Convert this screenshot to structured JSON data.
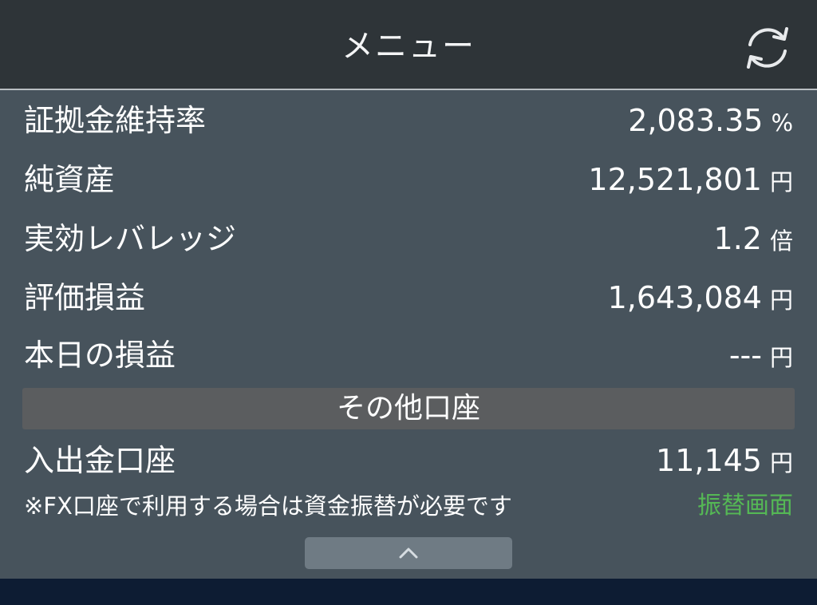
{
  "header": {
    "title": "メニュー",
    "refresh_icon": "refresh-icon"
  },
  "metrics": [
    {
      "label": "証拠金維持率",
      "value": "2,083.35",
      "unit": "%"
    },
    {
      "label": "純資産",
      "value": "12,521,801",
      "unit": "円"
    },
    {
      "label": "実効レバレッジ",
      "value": "1.2",
      "unit": "倍"
    },
    {
      "label": "評価損益",
      "value": "1,643,084",
      "unit": "円"
    },
    {
      "label": "本日の損益",
      "value": "---",
      "unit": "円"
    }
  ],
  "other_accounts": {
    "section_title": "その他口座",
    "deposit": {
      "label": "入出金口座",
      "value": "11,145",
      "unit": "円"
    },
    "note": "※FX口座で利用する場合は資金振替が必要です",
    "transfer_link": "振替画面",
    "transfer_link_color": "#55b855"
  },
  "collapse": {
    "icon": "chevron-up-icon"
  },
  "colors": {
    "header_bg": "#2e3438",
    "content_bg": "#47535c",
    "section_bg": "#5b5d5f",
    "footer_bg": "#0d1c33"
  }
}
